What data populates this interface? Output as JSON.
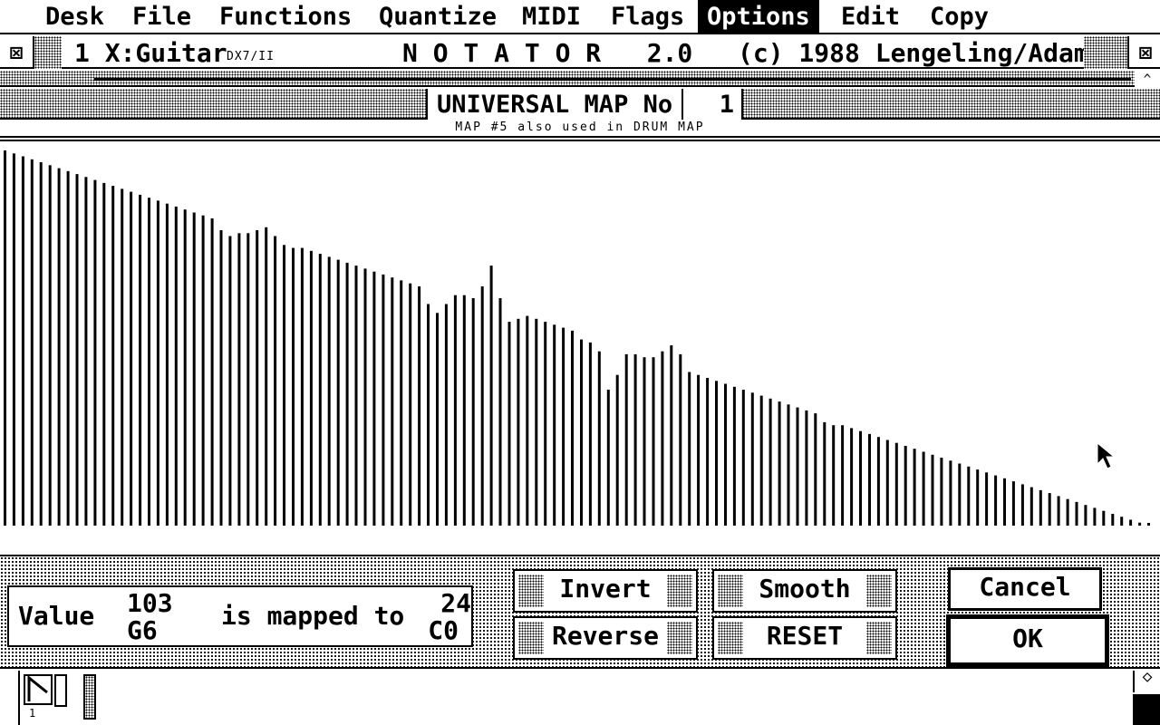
{
  "menubar": {
    "items": [
      "Desk",
      "File",
      "Functions",
      "Quantize",
      "MIDI",
      "Flags",
      "Options",
      "Edit",
      "Copy"
    ],
    "active": "Options"
  },
  "titlebar": {
    "track": "1 X:Guitar",
    "instrument": "DX7/II",
    "app": "N O T A T O R   2.0",
    "copyright": "(c) 1988 Lengeling/Adam"
  },
  "map": {
    "title": "UNIVERSAL MAP No",
    "number": "1",
    "note": "MAP #5 also used in DRUM MAP"
  },
  "chart_data": {
    "type": "bar",
    "ylim": [
      0,
      127
    ],
    "values": [
      127,
      126,
      125,
      124,
      123,
      122,
      121,
      120,
      119,
      118,
      117,
      116,
      115,
      114,
      113,
      112,
      111,
      110,
      109,
      108,
      107,
      106,
      105,
      104,
      100,
      98,
      99,
      99,
      100,
      101,
      98,
      95,
      94,
      94,
      93,
      92,
      91,
      90,
      89,
      88,
      87,
      86,
      85,
      84,
      83,
      82,
      81,
      75,
      72,
      75,
      78,
      78,
      77,
      81,
      88,
      77,
      69,
      70,
      71,
      70,
      69,
      68,
      67,
      66,
      63,
      62,
      59,
      46,
      51,
      58,
      58,
      57,
      57,
      59,
      61,
      58,
      52,
      51,
      50,
      49,
      48,
      47,
      46,
      45,
      44,
      43,
      42,
      41,
      40,
      39,
      38,
      35,
      34,
      34,
      33,
      32,
      31,
      30,
      29,
      28,
      27,
      26,
      25,
      24,
      23,
      22,
      21,
      20,
      19,
      18,
      17,
      16,
      15,
      14,
      13,
      12,
      11,
      10,
      9,
      8,
      7,
      6,
      5,
      4,
      3,
      2,
      1,
      0
    ]
  },
  "mapping": {
    "value_label": "Value",
    "value_num": "103",
    "value_note": "G6",
    "mapped_label": "is mapped to",
    "mapped_num": "24",
    "mapped_note": "C0"
  },
  "buttons": {
    "invert": "Invert",
    "reverse": "Reverse",
    "smooth": "Smooth",
    "reset": "RESET",
    "cancel": "Cancel",
    "ok": "OK"
  },
  "footer": {
    "marker": "1"
  },
  "icons": [
    "close-icon",
    "scroll-up-icon",
    "mouse-pointer-icon",
    "note-icon",
    "scroll-down-icon"
  ]
}
